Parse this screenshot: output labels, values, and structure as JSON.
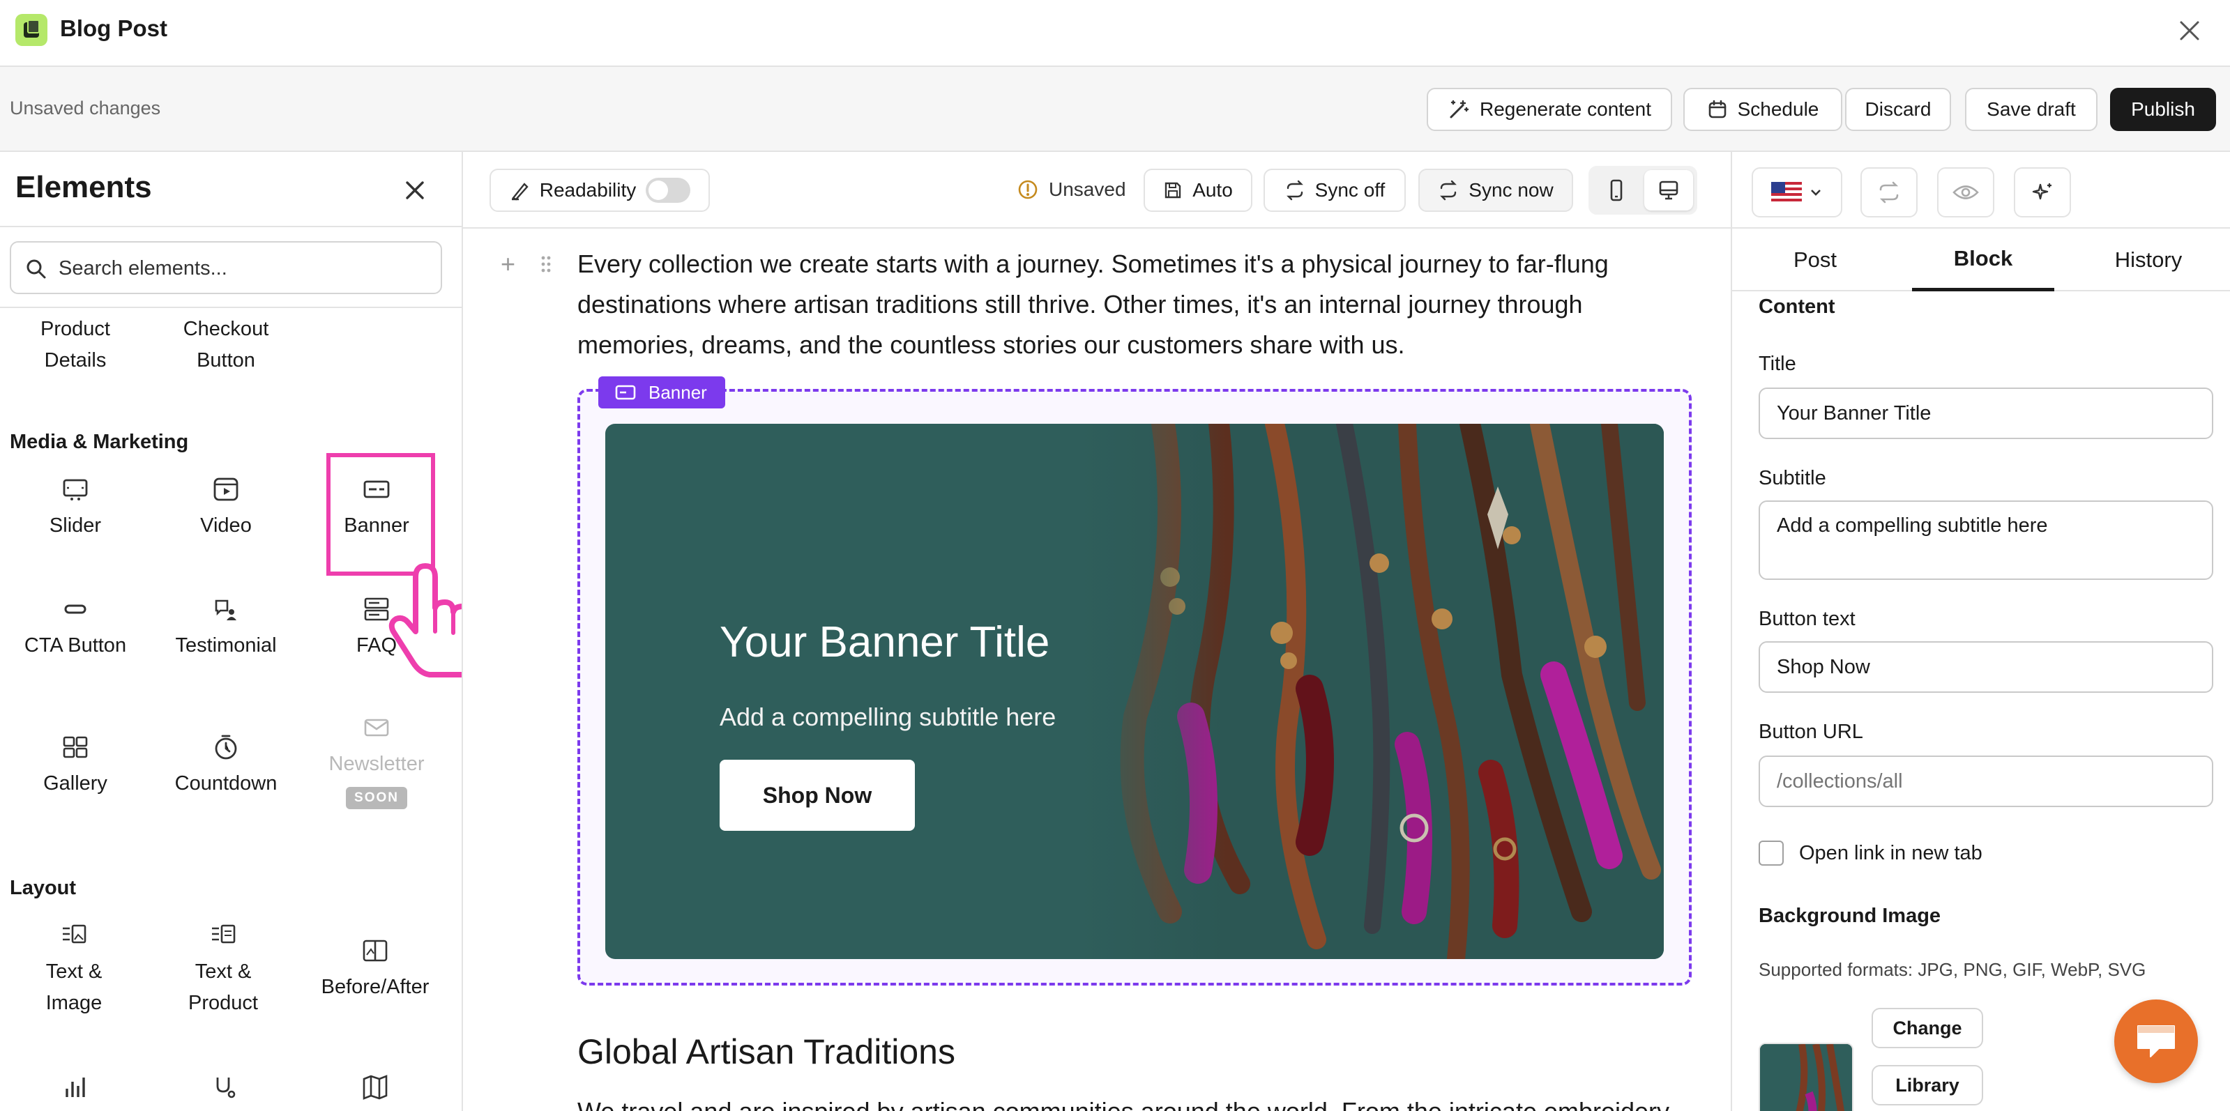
{
  "window": {
    "title": "Blog Post"
  },
  "actionbar": {
    "status": "Unsaved changes",
    "buttons": {
      "regenerate": "Regenerate content",
      "schedule": "Schedule",
      "discard": "Discard",
      "save_draft": "Save draft",
      "publish": "Publish"
    }
  },
  "elements_panel": {
    "title": "Elements",
    "search_placeholder": "Search elements...",
    "top_items": {
      "product_details": "Product Details",
      "checkout_button": "Checkout Button"
    },
    "sections": {
      "media": {
        "label": "Media & Marketing",
        "items": {
          "slider": "Slider",
          "video": "Video",
          "banner": "Banner",
          "cta": "CTA Button",
          "testimonial": "Testimonial",
          "faq": "FAQ",
          "gallery": "Gallery",
          "countdown": "Countdown",
          "newsletter": "Newsletter"
        },
        "soon_badge": "SOON"
      },
      "layout": {
        "label": "Layout",
        "items": {
          "text_image": "Text & Image",
          "text_product": "Text & Product",
          "before_after": "Before/After"
        }
      }
    }
  },
  "editor": {
    "toolbar": {
      "readability": "Readability",
      "readability_on": false,
      "unsaved": "Unsaved",
      "auto": "Auto",
      "sync_off": "Sync off",
      "sync_now": "Sync now",
      "device_selected": "desktop"
    },
    "paragraph": "Every collection we create starts with a journey. Sometimes it's a physical journey to far-flung destinations where artisan traditions still thrive. Other times, it's an internal journey through memories, dreams, and the countless stories our customers share with us.",
    "banner_block": {
      "tag": "Banner",
      "title": "Your Banner Title",
      "subtitle": "Add a compelling subtitle here",
      "button": "Shop Now"
    },
    "section_heading": "Global Artisan Traditions",
    "next_text": "We travel and are inspired by artisan communities around the world. From the intricate embroidery"
  },
  "settings_panel": {
    "language_flag": "us-flag",
    "tabs": [
      "Post",
      "Block",
      "History"
    ],
    "active_tab": "Block",
    "content_label": "Content",
    "fields": {
      "title_label": "Title",
      "title_value": "Your Banner Title",
      "subtitle_label": "Subtitle",
      "subtitle_value": "Add a compelling subtitle here",
      "button_text_label": "Button text",
      "button_text_value": "Shop Now",
      "button_url_label": "Button URL",
      "button_url_placeholder": "/collections/all"
    },
    "open_new_tab": "Open link in new tab",
    "open_new_tab_checked": false,
    "background_image": "Background Image",
    "supported_formats": "Supported formats: JPG, PNG, GIF, WebP, SVG",
    "change": "Change",
    "library": "Library"
  },
  "colors": {
    "accent": "#7c3aed",
    "highlight": "#ee3ead",
    "banner_bg": "#2f5e5b",
    "chat": "#e8702a",
    "publish_bg": "#1a1a1a"
  }
}
